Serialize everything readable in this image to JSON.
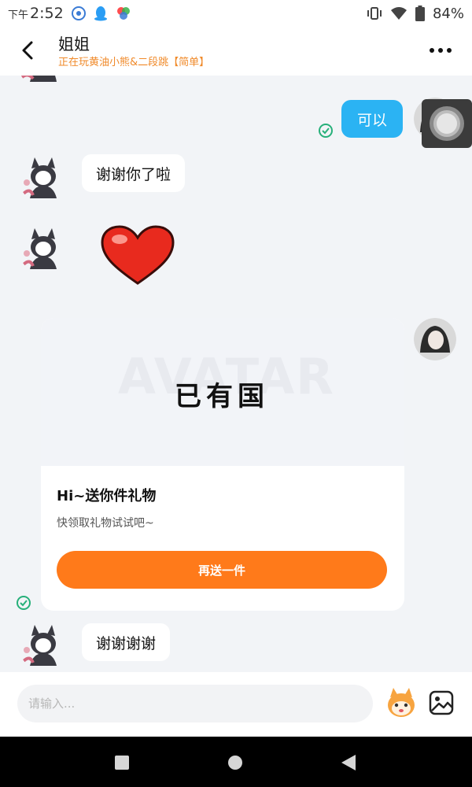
{
  "status_bar": {
    "time_prefix": "下午",
    "time": "2:52",
    "battery": "84%",
    "icons": [
      "app-icon-blue",
      "qq-icon",
      "colorful-app-icon",
      "vibrate-icon",
      "wifi-icon",
      "battery-icon"
    ]
  },
  "header": {
    "title": "姐姐",
    "subtitle": "正在玩黄油小熊&二段跳【简单】",
    "back_icon": "chevron-left-icon",
    "more_icon": "more-dots-icon"
  },
  "messages": [
    {
      "side": "right",
      "type": "text",
      "text": "可以",
      "status": "sent-check"
    },
    {
      "side": "left",
      "type": "text",
      "text": "谢谢你了啦"
    },
    {
      "side": "left",
      "type": "sticker",
      "sticker": "red-heart"
    },
    {
      "side": "right",
      "type": "gift",
      "status": "sent-check"
    },
    {
      "side": "left",
      "type": "text",
      "text": "谢谢谢谢"
    }
  ],
  "gift_card": {
    "image_text": "已有国",
    "image_watermark": "AVATAR",
    "title": "Hi~送你件礼物",
    "description": "快领取礼物试试吧~",
    "button_label": "再送一件"
  },
  "input_bar": {
    "placeholder": "请输入...",
    "emoji_icon": "mascot-emoji-icon",
    "image_icon": "image-picker-icon"
  },
  "nav_bar": {
    "icons": [
      "recent-apps-icon",
      "home-icon",
      "back-triangle-icon"
    ]
  },
  "colors": {
    "accent_orange": "#ff7a1a",
    "bubble_blue": "#2bb3f3",
    "subtitle_orange": "#f08a2a",
    "check_green": "#27b07a"
  }
}
